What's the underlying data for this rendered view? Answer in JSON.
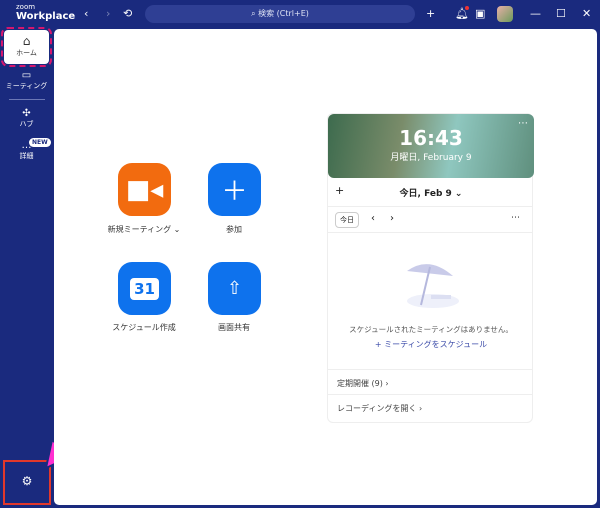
{
  "app": {
    "logo_top": "zoom",
    "logo_bottom": "Workplace"
  },
  "topbar": {
    "search_placeholder": "検索 (Ctrl+E)",
    "back": "‹",
    "forward": "›",
    "history": "⟲",
    "plus": "+",
    "minimize": "—",
    "maximize": "☐",
    "close": "✕"
  },
  "sidebar": {
    "items": [
      {
        "label": "ホーム"
      },
      {
        "label": "ミーティング"
      },
      {
        "label": "ハブ"
      },
      {
        "label": "詳細",
        "badge": "NEW"
      }
    ]
  },
  "actions": [
    {
      "label": "新規ミーティング ⌄",
      "color": "#f26b0f"
    },
    {
      "label": "参加",
      "color": "#0e72ed"
    },
    {
      "label": "スケジュール作成",
      "color": "#0e72ed",
      "day": "31"
    },
    {
      "label": "画面共有",
      "color": "#0e72ed"
    }
  ],
  "calendar": {
    "time": "16:43",
    "date": "月曜日, February 9",
    "header": "今日, Feb 9 ⌄",
    "today_btn": "今日",
    "empty": "スケジュールされたミーティングはありません。",
    "schedule_link": "+ ミーティングをスケジュール",
    "recurring": "定期開催 (9)  ›",
    "recordings": "レコーディングを開く  ›"
  },
  "colors": {
    "accent": "#0e72ed",
    "orange": "#f26b0f",
    "nav": "#1a2a7e"
  }
}
